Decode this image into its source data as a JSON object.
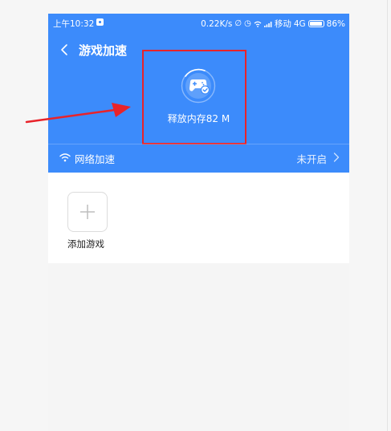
{
  "status_bar": {
    "time": "上午10:32",
    "net_speed": "0.22K/s",
    "carrier": "移动",
    "network_type": "4G",
    "battery": "86%"
  },
  "header": {
    "title": "游戏加速",
    "release_memory": "释放内存82 M"
  },
  "network": {
    "label": "网络加速",
    "status": "未开启"
  },
  "games": {
    "add_label": "添加游戏"
  },
  "colors": {
    "header_blue": "#3c8bfb",
    "annotation_red": "#e8232a"
  },
  "icons": [
    "chevron-left-icon",
    "gamepad-icon",
    "wifi-icon",
    "chevron-right-icon",
    "plus-icon"
  ]
}
